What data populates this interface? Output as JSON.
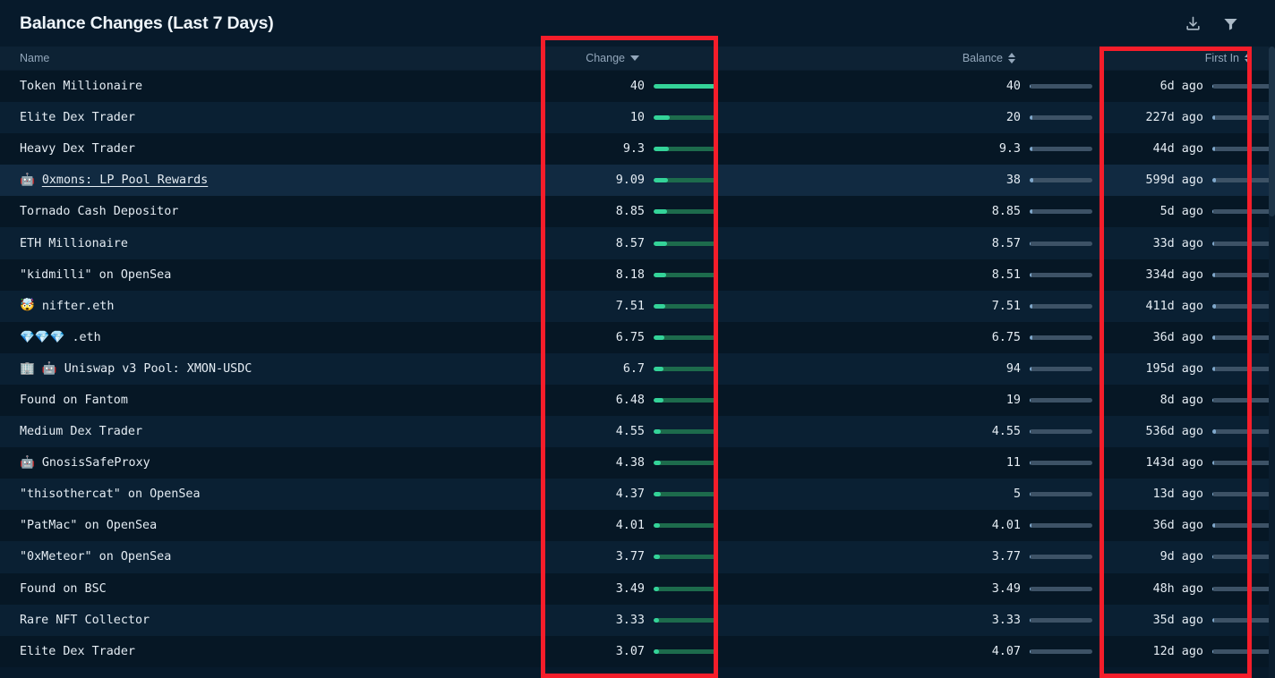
{
  "header": {
    "title": "Balance Changes (Last 7 Days)",
    "actions": [
      {
        "name": "download-icon",
        "label": "Download"
      },
      {
        "name": "filter-icon",
        "label": "Filter"
      }
    ]
  },
  "table": {
    "columns": [
      {
        "key": "name",
        "label": "Name",
        "sort": "none",
        "align": "left"
      },
      {
        "key": "change",
        "label": "Change",
        "sort": "desc",
        "align": "right"
      },
      {
        "key": "balance",
        "label": "Balance",
        "sort": "both",
        "align": "right"
      },
      {
        "key": "first_in",
        "label": "First In",
        "sort": "both",
        "align": "right"
      }
    ],
    "rows": [
      {
        "name": "Token Millionaire",
        "emoji": "",
        "link": false,
        "change": "40",
        "change_pct": 100,
        "balance": "40",
        "balance_pct": 2,
        "first_in": "6d ago",
        "first_pct": 0
      },
      {
        "name": "Elite Dex Trader",
        "emoji": "",
        "link": false,
        "change": "10",
        "change_pct": 26,
        "balance": "20",
        "balance_pct": 4,
        "first_in": "227d ago",
        "first_pct": 4
      },
      {
        "name": "Heavy Dex Trader",
        "emoji": "",
        "link": false,
        "change": "9.3",
        "change_pct": 24,
        "balance": "9.3",
        "balance_pct": 4,
        "first_in": "44d ago",
        "first_pct": 4
      },
      {
        "name": "0xmons: LP Pool Rewards",
        "emoji": "🤖",
        "link": true,
        "change": "9.09",
        "change_pct": 23,
        "balance": "38",
        "balance_pct": 5,
        "first_in": "599d ago",
        "first_pct": 6
      },
      {
        "name": "Tornado Cash Depositor",
        "emoji": "",
        "link": false,
        "change": "8.85",
        "change_pct": 22,
        "balance": "8.85",
        "balance_pct": 4,
        "first_in": "5d ago",
        "first_pct": 0
      },
      {
        "name": "ETH Millionaire",
        "emoji": "",
        "link": false,
        "change": "8.57",
        "change_pct": 21,
        "balance": "8.57",
        "balance_pct": 2,
        "first_in": "33d ago",
        "first_pct": 3
      },
      {
        "name": "\"kidmilli\" on OpenSea",
        "emoji": "",
        "link": false,
        "change": "8.18",
        "change_pct": 20,
        "balance": "8.51",
        "balance_pct": 3,
        "first_in": "334d ago",
        "first_pct": 4
      },
      {
        "name": "nifter.eth",
        "emoji": "🤯",
        "link": false,
        "change": "7.51",
        "change_pct": 18,
        "balance": "7.51",
        "balance_pct": 4,
        "first_in": "411d ago",
        "first_pct": 5
      },
      {
        "name": ".eth",
        "emoji": "💎💎💎",
        "link": false,
        "change": "6.75",
        "change_pct": 17,
        "balance": "6.75",
        "balance_pct": 4,
        "first_in": "36d ago",
        "first_pct": 4
      },
      {
        "name": "Uniswap v3 Pool: XMON-USDC",
        "emoji": "🏢 🤖",
        "link": false,
        "change": "6.7",
        "change_pct": 16,
        "balance": "94",
        "balance_pct": 3,
        "first_in": "195d ago",
        "first_pct": 4
      },
      {
        "name": "Found on Fantom",
        "emoji": "",
        "link": false,
        "change": "6.48",
        "change_pct": 15,
        "balance": "19",
        "balance_pct": 2,
        "first_in": "8d ago",
        "first_pct": 0
      },
      {
        "name": "Medium Dex Trader",
        "emoji": "",
        "link": false,
        "change": "4.55",
        "change_pct": 12,
        "balance": "4.55",
        "balance_pct": 2,
        "first_in": "536d ago",
        "first_pct": 5
      },
      {
        "name": "GnosisSafeProxy",
        "emoji": "🤖",
        "link": false,
        "change": "4.38",
        "change_pct": 11,
        "balance": "11",
        "balance_pct": 2,
        "first_in": "143d ago",
        "first_pct": 3
      },
      {
        "name": "\"thisothercat\" on OpenSea",
        "emoji": "",
        "link": false,
        "change": "4.37",
        "change_pct": 11,
        "balance": "5",
        "balance_pct": 2,
        "first_in": "13d ago",
        "first_pct": 0
      },
      {
        "name": "\"PatMac\" on OpenSea",
        "emoji": "",
        "link": false,
        "change": "4.01",
        "change_pct": 10,
        "balance": "4.01",
        "balance_pct": 3,
        "first_in": "36d ago",
        "first_pct": 4
      },
      {
        "name": "\"0xMeteor\" on OpenSea",
        "emoji": "",
        "link": false,
        "change": "3.77",
        "change_pct": 10,
        "balance": "3.77",
        "balance_pct": 2,
        "first_in": "9d ago",
        "first_pct": 0
      },
      {
        "name": "Found on BSC",
        "emoji": "",
        "link": false,
        "change": "3.49",
        "change_pct": 9,
        "balance": "3.49",
        "balance_pct": 2,
        "first_in": "48h ago",
        "first_pct": 0
      },
      {
        "name": "Rare NFT Collector",
        "emoji": "",
        "link": false,
        "change": "3.33",
        "change_pct": 8,
        "balance": "3.33",
        "balance_pct": 2,
        "first_in": "35d ago",
        "first_pct": 3
      },
      {
        "name": "Elite Dex Trader",
        "emoji": "",
        "link": false,
        "change": "3.07",
        "change_pct": 8,
        "balance": "4.07",
        "balance_pct": 2,
        "first_in": "12d ago",
        "first_pct": 0
      }
    ]
  },
  "annotations": [
    {
      "name": "change-column-highlight",
      "color": "#f51d2a"
    },
    {
      "name": "first-in-column-highlight",
      "color": "#f51d2a"
    }
  ],
  "colors": {
    "background": "#071a2b",
    "row": "#061725",
    "row_alt": "#0a2033",
    "row_selected": "#112a41",
    "header_row": "#0d2234",
    "bar_green_fill": "#34d399",
    "bar_green_track": "#1d6b4c",
    "bar_slate_fill": "#7fa8cc",
    "bar_slate_track": "#3d5266",
    "text": "#e4ecf3",
    "muted": "#93a7bb"
  }
}
